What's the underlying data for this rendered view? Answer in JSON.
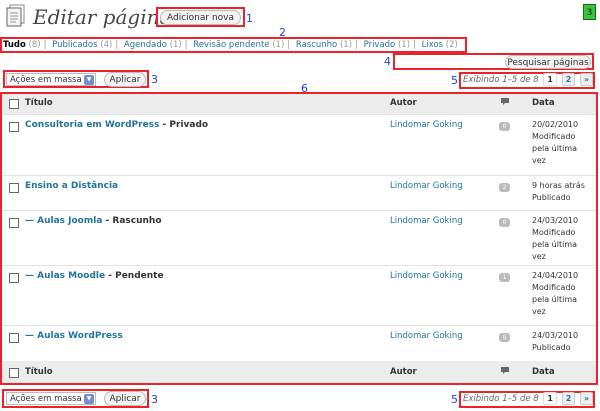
{
  "page": {
    "title": "Editar páginas",
    "add_new_label": "Adicionar nova",
    "screen_options_badge": "3"
  },
  "annotations": [
    "1",
    "2",
    "3",
    "4",
    "5",
    "6",
    "3",
    "5"
  ],
  "filters": [
    {
      "label": "Tudo",
      "count": "(8)"
    },
    {
      "label": "Publicados",
      "count": "(4)"
    },
    {
      "label": "Agendado",
      "count": "(1)"
    },
    {
      "label": "Revisão pendente",
      "count": "(1)"
    },
    {
      "label": "Rascunho",
      "count": "(1)"
    },
    {
      "label": "Privado",
      "count": "(1)"
    },
    {
      "label": "Lixos",
      "count": "(2)"
    }
  ],
  "search": {
    "button_label": "Pesquisar páginas"
  },
  "bulk": {
    "selected": "Ações em massa",
    "apply_label": "Aplicar"
  },
  "pagination": {
    "info": "Exibindo 1–5 de 8",
    "pages": [
      "1",
      "2"
    ],
    "next": "»"
  },
  "table": {
    "columns": {
      "title": "Título",
      "author": "Autor",
      "date": "Data"
    },
    "rows": [
      {
        "title": "Consultoria em WordPress",
        "state": " - Privado",
        "author": "Lindomar Goking",
        "comments": "0",
        "date_lines": [
          "20/02/2010",
          "Modificado",
          "pela última",
          "vez"
        ]
      },
      {
        "title": "Ensino a Distância",
        "state": "",
        "author": "Lindomar Goking",
        "comments": "2",
        "date_lines": [
          "9 horas atrás",
          "Publicado"
        ]
      },
      {
        "title": "— Aulas Joomla",
        "state": " - Rascunho",
        "author": "Lindomar Goking",
        "comments": "0",
        "date_lines": [
          "24/03/2010",
          "Modificado",
          "pela última",
          "vez"
        ]
      },
      {
        "title": "— Aulas Moodle",
        "state": " - Pendente",
        "author": "Lindomar Goking",
        "comments": "1",
        "date_lines": [
          "24/04/2010",
          "Modificado",
          "pela última",
          "vez"
        ]
      },
      {
        "title": "— Aulas WordPress",
        "state": "",
        "author": "Lindomar Goking",
        "comments": "0",
        "date_lines": [
          "24/03/2010",
          "Publicado"
        ]
      }
    ]
  }
}
